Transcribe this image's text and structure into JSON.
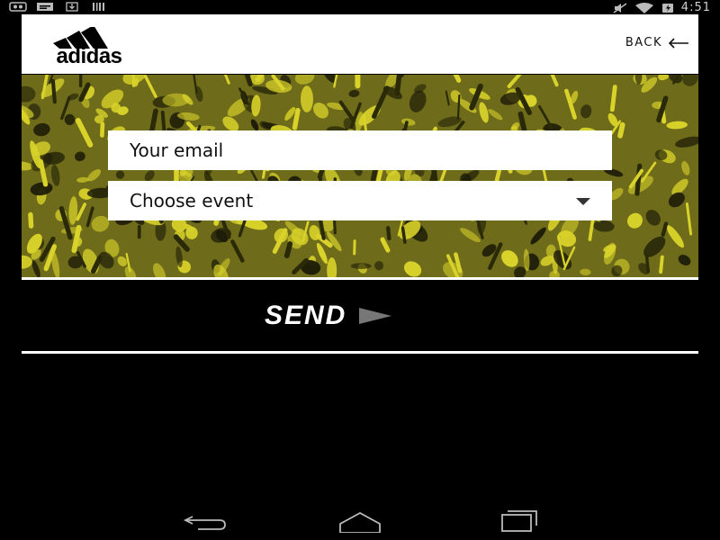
{
  "status_bar": {
    "time": "4:51",
    "left_icons": [
      "notification-icon",
      "message-icon",
      "download-icon",
      "barcode-icon"
    ],
    "right_icons": [
      "mute-icon",
      "wifi-icon",
      "battery-icon"
    ]
  },
  "header": {
    "logo_text": "adidas",
    "back_label": "BACK"
  },
  "form": {
    "email_placeholder": "Your email",
    "event_selected": "Choose event"
  },
  "send_label": "SEND",
  "colors": {
    "accent_yellow": "#d8d22a",
    "background": "#000000",
    "panel": "#ffffff",
    "arrow_grey": "#777777"
  },
  "nav": [
    "back-icon",
    "home-icon",
    "recents-icon"
  ]
}
